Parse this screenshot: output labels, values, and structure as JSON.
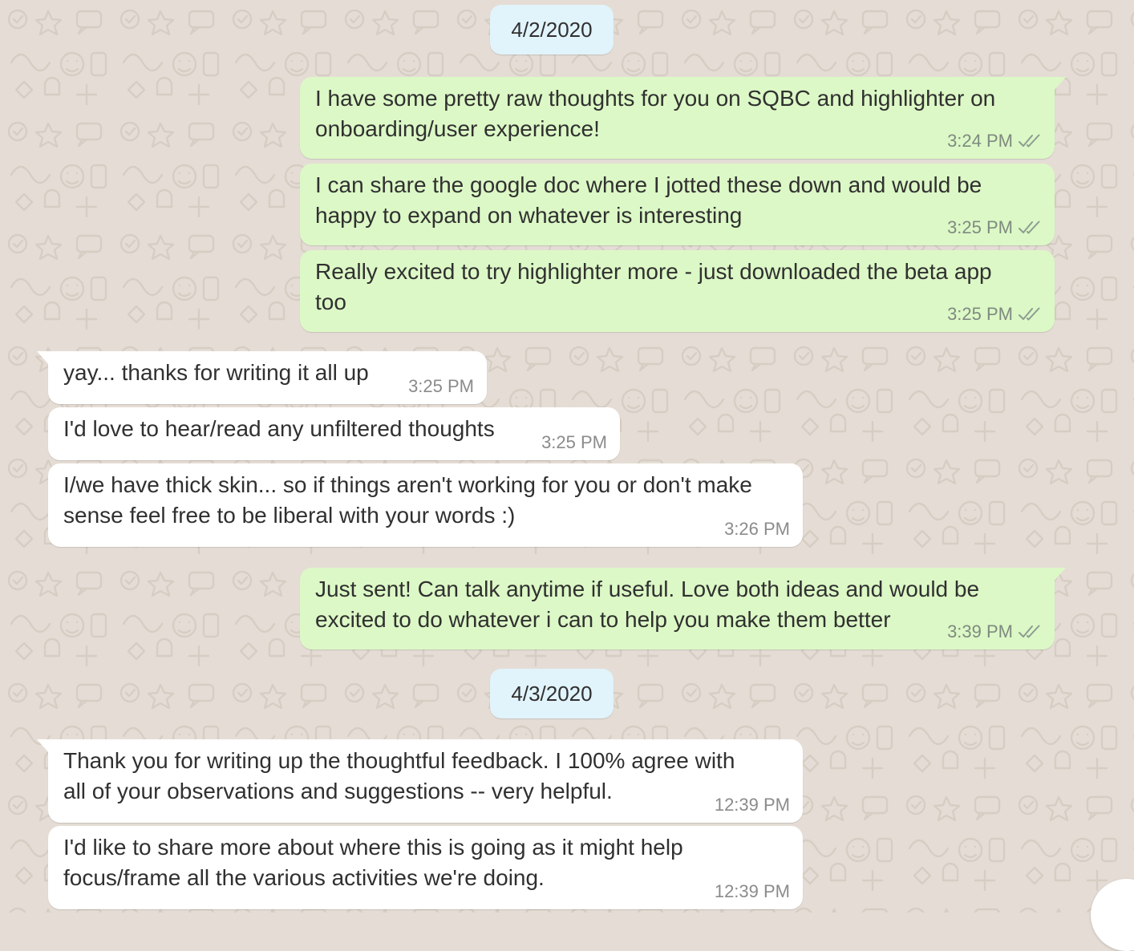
{
  "conversation": {
    "dates": [
      {
        "label": "4/2/2020"
      },
      {
        "label": "4/3/2020"
      }
    ],
    "messages": [
      {
        "direction": "outgoing",
        "text": "I have some pretty raw thoughts for you on SQBC and highlighter on\nonboarding/user experience!",
        "time": "3:24 PM",
        "status": "double-check-icon"
      },
      {
        "direction": "outgoing",
        "text": "I can share the google doc where I jotted these down and would be\nhappy to expand on whatever is interesting",
        "time": "3:25 PM",
        "status": "double-check-icon"
      },
      {
        "direction": "outgoing",
        "text": "Really excited to try highlighter more - just downloaded the beta app\ntoo",
        "time": "3:25 PM",
        "status": "double-check-icon"
      },
      {
        "direction": "incoming",
        "text": "yay... thanks for writing it all up",
        "time": "3:25 PM"
      },
      {
        "direction": "incoming",
        "text": "I'd love to hear/read any unfiltered thoughts",
        "time": "3:25 PM"
      },
      {
        "direction": "incoming",
        "text": "I/we have thick skin... so if things aren't working for you or don't make\nsense feel free to be liberal with your words :)",
        "time": "3:26 PM"
      },
      {
        "direction": "outgoing",
        "text": "Just sent! Can talk anytime if useful. Love both ideas and would be\nexcited to do whatever i can to help you make them better",
        "time": "3:39 PM",
        "status": "double-check-icon"
      },
      {
        "direction": "incoming",
        "text": "Thank you for writing up the thoughtful feedback.  I 100% agree with\nall of your observations and suggestions -- very helpful.",
        "time": "12:39 PM"
      },
      {
        "direction": "incoming",
        "text": "I'd like to share more about where this is going as it might help\nfocus/frame all the various activities we're doing.",
        "time": "12:39 PM"
      }
    ]
  },
  "colors": {
    "background": "#e5ddd5",
    "outgoing_bubble": "#dcf8c6",
    "incoming_bubble": "#ffffff",
    "date_chip": "#e1f3fb",
    "message_text": "#303030",
    "timestamp": "#7f8a80"
  }
}
